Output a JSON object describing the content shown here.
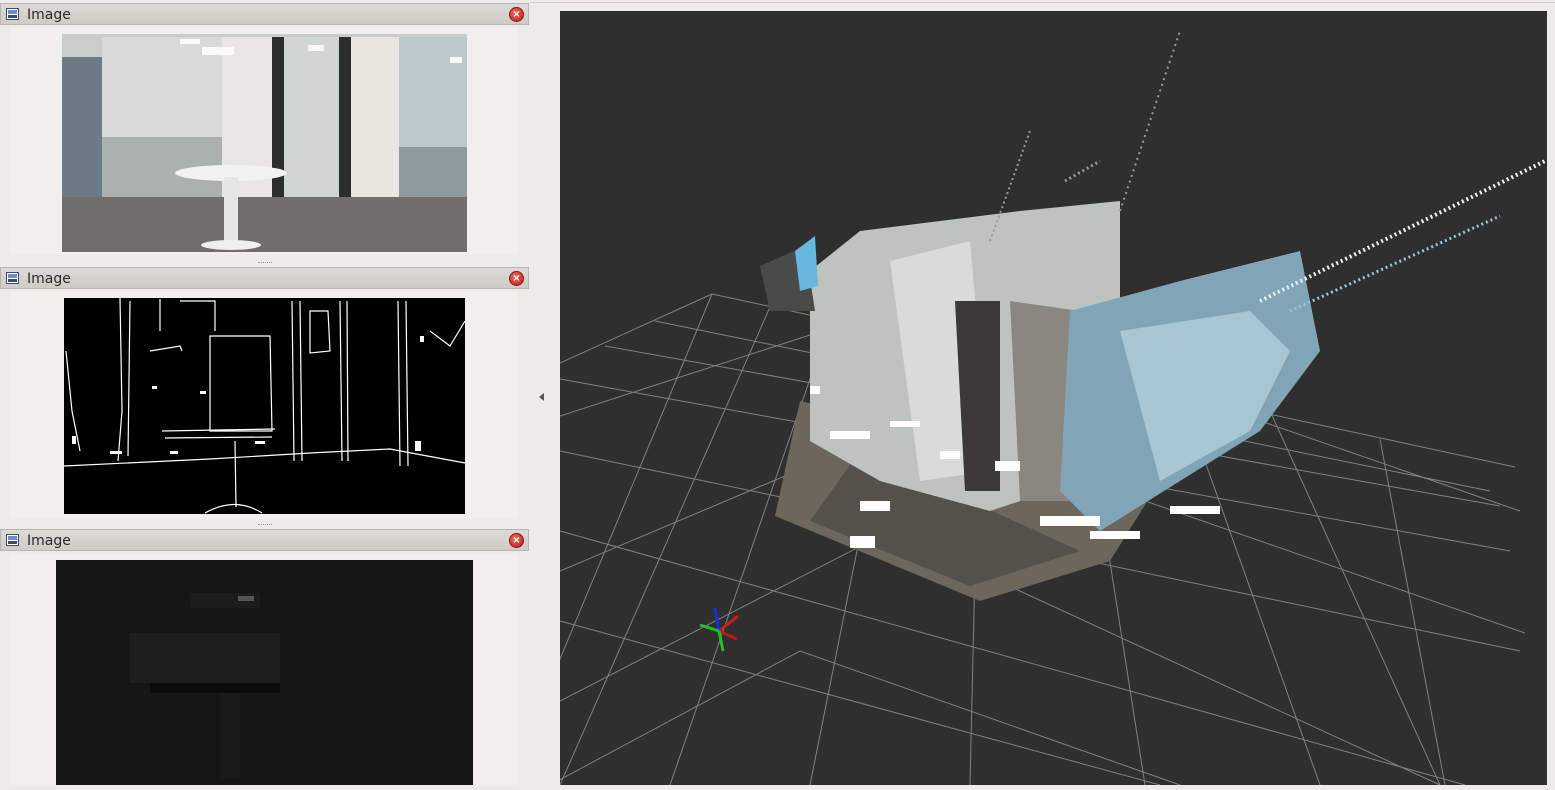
{
  "panels": [
    {
      "title": "Image",
      "kind": "rgb"
    },
    {
      "title": "Image",
      "kind": "edges"
    },
    {
      "title": "Image",
      "kind": "depth"
    }
  ],
  "viewport": {
    "background": "#2f2f2f",
    "grid_color": "#8a8a8a"
  },
  "icons": {
    "window": "image-window-icon",
    "close": "close-icon",
    "splitter": "collapse-arrow-icon"
  }
}
